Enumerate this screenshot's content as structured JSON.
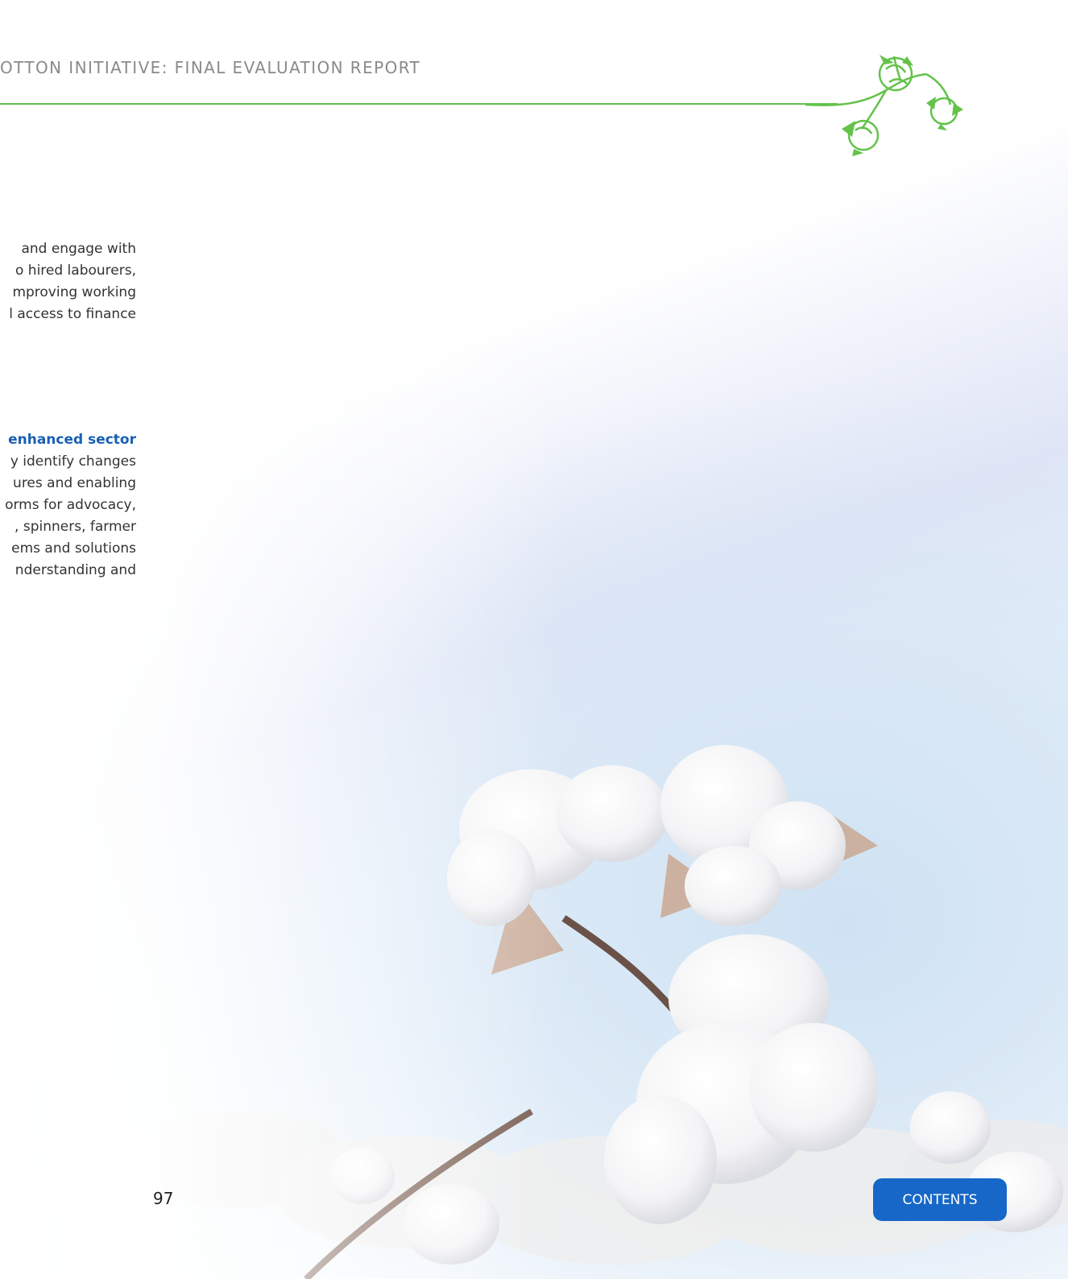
{
  "header": {
    "title": "OTTON INITIATIVE: FINAL EVALUATION REPORT",
    "decoration_icon": "cotton-branch-icon",
    "rule_color": "#63c24a"
  },
  "paragraph_1": {
    "lines": [
      "and engage with",
      "o hired labourers,",
      "mproving working",
      "l access to finance"
    ]
  },
  "paragraph_2": {
    "heading": "enhanced sector",
    "lines": [
      "y identify changes",
      "ures and enabling",
      "orms for advocacy,",
      ", spinners, farmer",
      "ems and solutions",
      "nderstanding and"
    ],
    "heading_color": "#1a5fb4"
  },
  "background": {
    "image": "cotton-bolls-field-photo"
  },
  "footer": {
    "page_number": "97",
    "contents_button": "CONTENTS",
    "button_color": "#1767c8"
  }
}
